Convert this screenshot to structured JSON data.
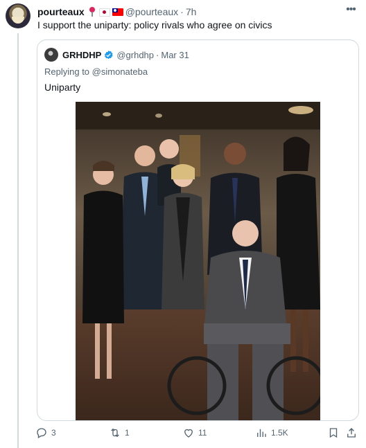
{
  "tweet": {
    "display_name": "pourteaux",
    "handle": "@pourteaux",
    "time": "7h",
    "text": "I support the uniparty: policy rivals who agree on civics",
    "badges": [
      "round-pushpin-emoji",
      "japan-flag-emoji",
      "taiwan-flag-emoji"
    ]
  },
  "quote": {
    "display_name": "GRHDHP",
    "verified": true,
    "handle": "@grhdhp",
    "date": "Mar 31",
    "reply_prefix": "Replying to",
    "reply_to": "@simonateba",
    "text": "Uniparty",
    "image": "photo-group-portrait"
  },
  "actions": {
    "replies": "3",
    "reposts": "1",
    "likes": "11",
    "views": "1.5K"
  },
  "colors": {
    "text": "#0f1419",
    "secondary": "#536471",
    "border": "#cfd9de",
    "verified": "#1d9bf0"
  }
}
